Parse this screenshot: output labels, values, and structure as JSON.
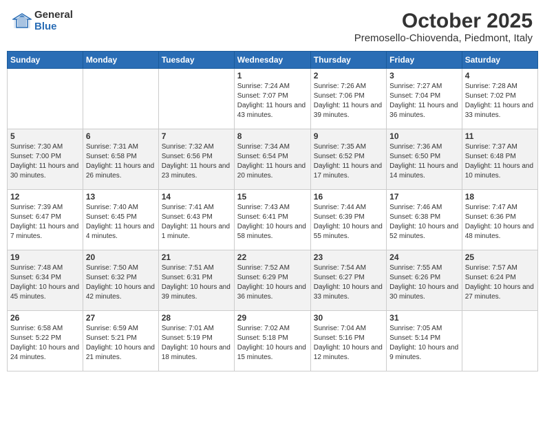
{
  "header": {
    "logo_general": "General",
    "logo_blue": "Blue",
    "title": "October 2025",
    "subtitle": "Premosello-Chiovenda, Piedmont, Italy"
  },
  "weekdays": [
    "Sunday",
    "Monday",
    "Tuesday",
    "Wednesday",
    "Thursday",
    "Friday",
    "Saturday"
  ],
  "weeks": [
    [
      {
        "day": "",
        "sunrise": "",
        "sunset": "",
        "daylight": ""
      },
      {
        "day": "",
        "sunrise": "",
        "sunset": "",
        "daylight": ""
      },
      {
        "day": "",
        "sunrise": "",
        "sunset": "",
        "daylight": ""
      },
      {
        "day": "1",
        "sunrise": "Sunrise: 7:24 AM",
        "sunset": "Sunset: 7:07 PM",
        "daylight": "Daylight: 11 hours and 43 minutes."
      },
      {
        "day": "2",
        "sunrise": "Sunrise: 7:26 AM",
        "sunset": "Sunset: 7:06 PM",
        "daylight": "Daylight: 11 hours and 39 minutes."
      },
      {
        "day": "3",
        "sunrise": "Sunrise: 7:27 AM",
        "sunset": "Sunset: 7:04 PM",
        "daylight": "Daylight: 11 hours and 36 minutes."
      },
      {
        "day": "4",
        "sunrise": "Sunrise: 7:28 AM",
        "sunset": "Sunset: 7:02 PM",
        "daylight": "Daylight: 11 hours and 33 minutes."
      }
    ],
    [
      {
        "day": "5",
        "sunrise": "Sunrise: 7:30 AM",
        "sunset": "Sunset: 7:00 PM",
        "daylight": "Daylight: 11 hours and 30 minutes."
      },
      {
        "day": "6",
        "sunrise": "Sunrise: 7:31 AM",
        "sunset": "Sunset: 6:58 PM",
        "daylight": "Daylight: 11 hours and 26 minutes."
      },
      {
        "day": "7",
        "sunrise": "Sunrise: 7:32 AM",
        "sunset": "Sunset: 6:56 PM",
        "daylight": "Daylight: 11 hours and 23 minutes."
      },
      {
        "day": "8",
        "sunrise": "Sunrise: 7:34 AM",
        "sunset": "Sunset: 6:54 PM",
        "daylight": "Daylight: 11 hours and 20 minutes."
      },
      {
        "day": "9",
        "sunrise": "Sunrise: 7:35 AM",
        "sunset": "Sunset: 6:52 PM",
        "daylight": "Daylight: 11 hours and 17 minutes."
      },
      {
        "day": "10",
        "sunrise": "Sunrise: 7:36 AM",
        "sunset": "Sunset: 6:50 PM",
        "daylight": "Daylight: 11 hours and 14 minutes."
      },
      {
        "day": "11",
        "sunrise": "Sunrise: 7:37 AM",
        "sunset": "Sunset: 6:48 PM",
        "daylight": "Daylight: 11 hours and 10 minutes."
      }
    ],
    [
      {
        "day": "12",
        "sunrise": "Sunrise: 7:39 AM",
        "sunset": "Sunset: 6:47 PM",
        "daylight": "Daylight: 11 hours and 7 minutes."
      },
      {
        "day": "13",
        "sunrise": "Sunrise: 7:40 AM",
        "sunset": "Sunset: 6:45 PM",
        "daylight": "Daylight: 11 hours and 4 minutes."
      },
      {
        "day": "14",
        "sunrise": "Sunrise: 7:41 AM",
        "sunset": "Sunset: 6:43 PM",
        "daylight": "Daylight: 11 hours and 1 minute."
      },
      {
        "day": "15",
        "sunrise": "Sunrise: 7:43 AM",
        "sunset": "Sunset: 6:41 PM",
        "daylight": "Daylight: 10 hours and 58 minutes."
      },
      {
        "day": "16",
        "sunrise": "Sunrise: 7:44 AM",
        "sunset": "Sunset: 6:39 PM",
        "daylight": "Daylight: 10 hours and 55 minutes."
      },
      {
        "day": "17",
        "sunrise": "Sunrise: 7:46 AM",
        "sunset": "Sunset: 6:38 PM",
        "daylight": "Daylight: 10 hours and 52 minutes."
      },
      {
        "day": "18",
        "sunrise": "Sunrise: 7:47 AM",
        "sunset": "Sunset: 6:36 PM",
        "daylight": "Daylight: 10 hours and 48 minutes."
      }
    ],
    [
      {
        "day": "19",
        "sunrise": "Sunrise: 7:48 AM",
        "sunset": "Sunset: 6:34 PM",
        "daylight": "Daylight: 10 hours and 45 minutes."
      },
      {
        "day": "20",
        "sunrise": "Sunrise: 7:50 AM",
        "sunset": "Sunset: 6:32 PM",
        "daylight": "Daylight: 10 hours and 42 minutes."
      },
      {
        "day": "21",
        "sunrise": "Sunrise: 7:51 AM",
        "sunset": "Sunset: 6:31 PM",
        "daylight": "Daylight: 10 hours and 39 minutes."
      },
      {
        "day": "22",
        "sunrise": "Sunrise: 7:52 AM",
        "sunset": "Sunset: 6:29 PM",
        "daylight": "Daylight: 10 hours and 36 minutes."
      },
      {
        "day": "23",
        "sunrise": "Sunrise: 7:54 AM",
        "sunset": "Sunset: 6:27 PM",
        "daylight": "Daylight: 10 hours and 33 minutes."
      },
      {
        "day": "24",
        "sunrise": "Sunrise: 7:55 AM",
        "sunset": "Sunset: 6:26 PM",
        "daylight": "Daylight: 10 hours and 30 minutes."
      },
      {
        "day": "25",
        "sunrise": "Sunrise: 7:57 AM",
        "sunset": "Sunset: 6:24 PM",
        "daylight": "Daylight: 10 hours and 27 minutes."
      }
    ],
    [
      {
        "day": "26",
        "sunrise": "Sunrise: 6:58 AM",
        "sunset": "Sunset: 5:22 PM",
        "daylight": "Daylight: 10 hours and 24 minutes."
      },
      {
        "day": "27",
        "sunrise": "Sunrise: 6:59 AM",
        "sunset": "Sunset: 5:21 PM",
        "daylight": "Daylight: 10 hours and 21 minutes."
      },
      {
        "day": "28",
        "sunrise": "Sunrise: 7:01 AM",
        "sunset": "Sunset: 5:19 PM",
        "daylight": "Daylight: 10 hours and 18 minutes."
      },
      {
        "day": "29",
        "sunrise": "Sunrise: 7:02 AM",
        "sunset": "Sunset: 5:18 PM",
        "daylight": "Daylight: 10 hours and 15 minutes."
      },
      {
        "day": "30",
        "sunrise": "Sunrise: 7:04 AM",
        "sunset": "Sunset: 5:16 PM",
        "daylight": "Daylight: 10 hours and 12 minutes."
      },
      {
        "day": "31",
        "sunrise": "Sunrise: 7:05 AM",
        "sunset": "Sunset: 5:14 PM",
        "daylight": "Daylight: 10 hours and 9 minutes."
      },
      {
        "day": "",
        "sunrise": "",
        "sunset": "",
        "daylight": ""
      }
    ]
  ]
}
